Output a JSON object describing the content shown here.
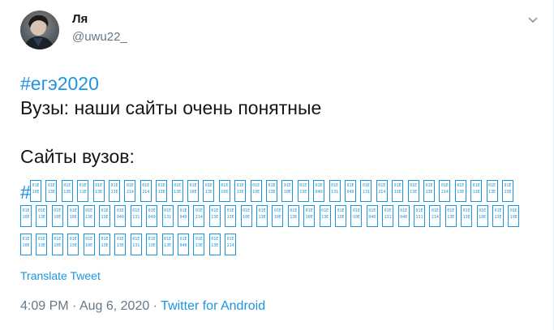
{
  "author": {
    "display_name": "Ля",
    "handle": "@uwu22_"
  },
  "tweet": {
    "hashtag": "#егэ2020",
    "line1": "Вузы: наши сайты очень понятные",
    "line2": "Сайты вузов:",
    "hashtag_prefix": "#",
    "unrendered_glyph_codes": [
      [
        "0 1 E 1 0 E",
        "0 1 E 1 3 E",
        "0 1 E 1 3 E",
        "0 1 E 1 1 E",
        "0 1 E 1 3 E",
        "0 1 E 1 3 E",
        "0 1 E 2 1 4",
        "0 1 E 2 1 4",
        "0 1 E 1 3 E",
        "0 1 E 1 3 E",
        "0 1 E 1 0 E",
        "0 1 E 1 3 E",
        "0 1 E 1 0 E",
        "0 1 E 1 3 E",
        "0 1 E 1 0 E",
        "0 1 E 1 3 E",
        "0 1 E 1 0 E",
        "0 1 E 1 3 E",
        "0 1 E 0 4 0",
        "0 1 E 1 3 1",
        "0 1 E 0 4 0",
        "0 1 E 1 3 1",
        "0 1 E 2 1 4",
        "0 1 E 1 3 E",
        "0 1 E 1 3 E",
        "0 1 E 1 3 E",
        "0 1 E 2 1 4",
        "0 1 E 1 3 E",
        "0 1 E 1 3 E",
        "0 1 E 1 3 E",
        "0 1 E 1 3 E"
      ],
      [
        "0 1 E 1 0 E",
        "0 1 E 1 3 E",
        "0 1 E 1 0 E",
        "0 1 E 1 0 E",
        "0 1 E 1 3 E",
        "0 1 E 1 3 E",
        "0 1 E 0 4 0",
        "0 1 E 1 3 1",
        "0 1 E 0 4 0",
        "0 1 E 1 3 1",
        "0 1 E 0 4 0",
        "0 1 E 2 1 4",
        "0 1 E 1 3 E",
        "0 1 E 1 3 E",
        "0 1 E 1 0 E",
        "0 1 E 1 3 E",
        "0 1 E 1 0 E",
        "0 1 E 1 3 E",
        "0 1 E 1 0 E",
        "0 1 E 1 3 E",
        "0 1 E 1 3 E",
        "0 1 E 1 0 E",
        "0 1 E 0 4 0",
        "0 1 E 1 3 1",
        "0 1 E 0 4 0",
        "0 1 E 1 3 1",
        "0 1 E 2 1 4",
        "0 1 E 1 3 E",
        "0 1 E 1 3 E",
        "0 1 E 1 0 E",
        "0 1 E 1 3 E",
        "0 1 E 1 0 E"
      ],
      [
        "0 1 E 1 0 E",
        "0 1 E 1 3 E",
        "0 1 E 1 0 E",
        "0 1 E 1 3 E",
        "0 1 E 1 0 E",
        "0 1 E 1 3 E",
        "0 1 E 1 3 E",
        "0 1 E 1 3 1",
        "0 1 E 1 3 E",
        "0 1 E 1 3 E",
        "0 1 E 0 4 0",
        "0 1 E 1 3 E",
        "0 1 E 1 3 E",
        "0 1 E 2 1 4"
      ]
    ]
  },
  "translate_label": "Translate Tweet",
  "meta": {
    "time": "4:09 PM",
    "separator1": " · ",
    "date": "Aug 6, 2020",
    "separator2": " · ",
    "source": "Twitter for Android"
  },
  "colors": {
    "link": "#1b95e0",
    "secondary": "#657786",
    "primary": "#14171a"
  },
  "icons": {
    "caret": "chevron-down-icon",
    "avatar": "avatar"
  }
}
